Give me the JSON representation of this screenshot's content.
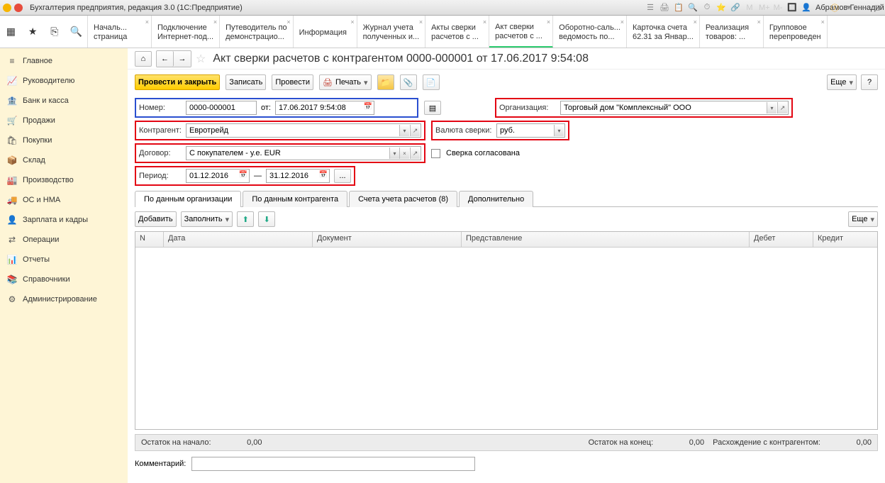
{
  "titlebar": {
    "app_title": "Бухгалтерия предприятия, редакция 3.0  (1С:Предприятие)",
    "user": "Абрамов Геннадий Серге..."
  },
  "doctabs": [
    {
      "l1": "Началь...",
      "l2": "страница"
    },
    {
      "l1": "Подключение",
      "l2": "Интернет-под..."
    },
    {
      "l1": "Путеводитель по",
      "l2": "демонстрацио..."
    },
    {
      "l1": "Информация",
      "l2": ""
    },
    {
      "l1": "Журнал учета",
      "l2": "полученных и..."
    },
    {
      "l1": "Акты сверки",
      "l2": "расчетов с ..."
    },
    {
      "l1": "Акт сверки",
      "l2": "расчетов с ..."
    },
    {
      "l1": "Оборотно-саль...",
      "l2": "ведомость по..."
    },
    {
      "l1": "Карточка счета",
      "l2": "62.31 за Январ..."
    },
    {
      "l1": "Реализация",
      "l2": "товаров: ..."
    },
    {
      "l1": "Групповое",
      "l2": "перепроведен"
    }
  ],
  "sidebar": {
    "items": [
      {
        "icon": "≡",
        "label": "Главное"
      },
      {
        "icon": "📈",
        "label": "Руководителю"
      },
      {
        "icon": "🏦",
        "label": "Банк и касса"
      },
      {
        "icon": "🛒",
        "label": "Продажи"
      },
      {
        "icon": "🛍",
        "label": "Покупки"
      },
      {
        "icon": "📦",
        "label": "Склад"
      },
      {
        "icon": "🏭",
        "label": "Производство"
      },
      {
        "icon": "🚚",
        "label": "ОС и НМА"
      },
      {
        "icon": "👤",
        "label": "Зарплата и кадры"
      },
      {
        "icon": "⇄",
        "label": "Операции"
      },
      {
        "icon": "📊",
        "label": "Отчеты"
      },
      {
        "icon": "📚",
        "label": "Справочники"
      },
      {
        "icon": "⚙",
        "label": "Администрирование"
      }
    ]
  },
  "doc": {
    "title": "Акт сверки расчетов с контрагентом 0000-000001 от 17.06.2017 9:54:08",
    "btn_post_close": "Провести и закрыть",
    "btn_record": "Записать",
    "btn_post": "Провести",
    "btn_print": "Печать",
    "btn_more": "Еще",
    "lbl_number": "Номер:",
    "number": "0000-000001",
    "lbl_from": "от:",
    "date": "17.06.2017  9:54:08",
    "lbl_org": "Организация:",
    "org": "Торговый дом \"Комплексный\" ООО",
    "lbl_partner": "Контрагент:",
    "partner": "Евротрейд",
    "lbl_currency": "Валюта сверки:",
    "currency": "руб.",
    "lbl_contract": "Договор:",
    "contract": "С покупателем - у.е. EUR",
    "lbl_agreed": "Сверка согласована",
    "lbl_period": "Период:",
    "period_from": "01.12.2016",
    "period_sep": "—",
    "period_to": "31.12.2016",
    "tabs": [
      "По данным организации",
      "По данным контрагента",
      "Счета учета расчетов (8)",
      "Дополнительно"
    ],
    "btn_add": "Добавить",
    "btn_fill": "Заполнить",
    "cols": {
      "n": "N",
      "date": "Дата",
      "doc": "Документ",
      "repr": "Представление",
      "debit": "Дебет",
      "credit": "Кредит"
    },
    "sum": {
      "start_lbl": "Остаток на начало:",
      "start": "0,00",
      "end_lbl": "Остаток на конец:",
      "end": "0,00",
      "diff_lbl": "Расхождение с контрагентом:",
      "diff": "0,00"
    },
    "lbl_comment": "Комментарий:"
  }
}
